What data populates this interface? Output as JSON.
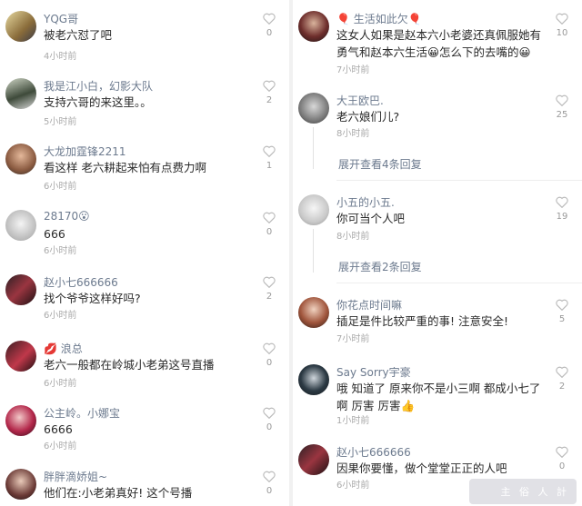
{
  "left": [
    {
      "name": "YQG哥",
      "text": "被老六怼了吧",
      "time": "4小时前",
      "likes": "0"
    },
    {
      "name": "我是江小白，幻影大队",
      "text": "支持六哥的来这里。。",
      "time": "5小时前",
      "likes": "2"
    },
    {
      "name": "大龙加霆锋2211",
      "text": "看这样 老六耕起来怕有点费力啊",
      "time": "6小时前",
      "likes": "1"
    },
    {
      "name": "28170😮",
      "text": "666",
      "time": "6小时前",
      "likes": "0"
    },
    {
      "name": "赵小七666666",
      "text": "找个爷爷这样好吗?",
      "time": "6小时前",
      "likes": "2"
    },
    {
      "name": "💋 浪总",
      "text": "老六一般都在岭城小老弟这号直播",
      "time": "6小时前",
      "likes": "0"
    },
    {
      "name": "公主岭。小娜宝",
      "text": "6666",
      "time": "6小时前",
      "likes": "0"
    },
    {
      "name": "胖胖滴娇姐~",
      "text": "他们在:小老弟真好! 这个号播",
      "time": "",
      "likes": "0"
    }
  ],
  "right": [
    {
      "name": "🎈 生活如此欠🎈",
      "text": "这女人如果是赵本六小老婆还真佩服她有勇气和赵本六生活😀怎么下的去嘴的😀",
      "time": "7小时前",
      "likes": "10"
    },
    {
      "name": "大王欧巴.",
      "text": "老六娘们儿?",
      "time": "8小时前",
      "likes": "25"
    },
    {
      "expand": "展开查看4条回复"
    },
    {
      "name": "小五的小五.",
      "text": "你可当个人吧",
      "time": "8小时前",
      "likes": "19"
    },
    {
      "expand": "展开查看2条回复"
    },
    {
      "name": "你花点时间嘛",
      "text": "插足是件比较严重的事! 注意安全!",
      "time": "7小时前",
      "likes": "5"
    },
    {
      "name": "Say Sorry宇豪",
      "text": "哦 知道了 原来你不是小三啊 都成小七了啊 厉害 厉害👍",
      "time": "1小时前",
      "likes": "2"
    },
    {
      "name": "赵小七666666",
      "text": "因果你要懂，做个堂堂正正的人吧",
      "time": "6小时前",
      "likes": "0"
    }
  ],
  "colors": {
    "name": "#6c7a8e",
    "text": "#2a2a2a",
    "time": "#aaaaaa"
  },
  "icons": {
    "like": "heart-outline-icon"
  },
  "watermark": "主  俗  人  計"
}
